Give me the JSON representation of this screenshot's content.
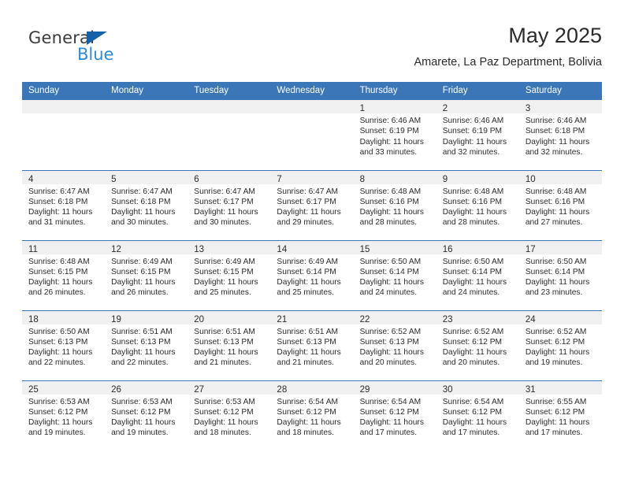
{
  "brand": {
    "name_part1": "General",
    "name_part2": "Blue",
    "color_dark": "#3b3b3b",
    "color_blue": "#2e8bd8",
    "triangle_color": "#1362a8"
  },
  "header": {
    "title": "May 2025",
    "subtitle": "Amarete, La Paz Department, Bolivia",
    "accent_color": "#3a76b8"
  },
  "weekdays": [
    "Sunday",
    "Monday",
    "Tuesday",
    "Wednesday",
    "Thursday",
    "Friday",
    "Saturday"
  ],
  "weeks": [
    [
      {
        "day": "",
        "lines": []
      },
      {
        "day": "",
        "lines": []
      },
      {
        "day": "",
        "lines": []
      },
      {
        "day": "",
        "lines": []
      },
      {
        "day": "1",
        "lines": [
          "Sunrise: 6:46 AM",
          "Sunset: 6:19 PM",
          "Daylight: 11 hours",
          "and 33 minutes."
        ]
      },
      {
        "day": "2",
        "lines": [
          "Sunrise: 6:46 AM",
          "Sunset: 6:19 PM",
          "Daylight: 11 hours",
          "and 32 minutes."
        ]
      },
      {
        "day": "3",
        "lines": [
          "Sunrise: 6:46 AM",
          "Sunset: 6:18 PM",
          "Daylight: 11 hours",
          "and 32 minutes."
        ]
      }
    ],
    [
      {
        "day": "4",
        "lines": [
          "Sunrise: 6:47 AM",
          "Sunset: 6:18 PM",
          "Daylight: 11 hours",
          "and 31 minutes."
        ]
      },
      {
        "day": "5",
        "lines": [
          "Sunrise: 6:47 AM",
          "Sunset: 6:18 PM",
          "Daylight: 11 hours",
          "and 30 minutes."
        ]
      },
      {
        "day": "6",
        "lines": [
          "Sunrise: 6:47 AM",
          "Sunset: 6:17 PM",
          "Daylight: 11 hours",
          "and 30 minutes."
        ]
      },
      {
        "day": "7",
        "lines": [
          "Sunrise: 6:47 AM",
          "Sunset: 6:17 PM",
          "Daylight: 11 hours",
          "and 29 minutes."
        ]
      },
      {
        "day": "8",
        "lines": [
          "Sunrise: 6:48 AM",
          "Sunset: 6:16 PM",
          "Daylight: 11 hours",
          "and 28 minutes."
        ]
      },
      {
        "day": "9",
        "lines": [
          "Sunrise: 6:48 AM",
          "Sunset: 6:16 PM",
          "Daylight: 11 hours",
          "and 28 minutes."
        ]
      },
      {
        "day": "10",
        "lines": [
          "Sunrise: 6:48 AM",
          "Sunset: 6:16 PM",
          "Daylight: 11 hours",
          "and 27 minutes."
        ]
      }
    ],
    [
      {
        "day": "11",
        "lines": [
          "Sunrise: 6:48 AM",
          "Sunset: 6:15 PM",
          "Daylight: 11 hours",
          "and 26 minutes."
        ]
      },
      {
        "day": "12",
        "lines": [
          "Sunrise: 6:49 AM",
          "Sunset: 6:15 PM",
          "Daylight: 11 hours",
          "and 26 minutes."
        ]
      },
      {
        "day": "13",
        "lines": [
          "Sunrise: 6:49 AM",
          "Sunset: 6:15 PM",
          "Daylight: 11 hours",
          "and 25 minutes."
        ]
      },
      {
        "day": "14",
        "lines": [
          "Sunrise: 6:49 AM",
          "Sunset: 6:14 PM",
          "Daylight: 11 hours",
          "and 25 minutes."
        ]
      },
      {
        "day": "15",
        "lines": [
          "Sunrise: 6:50 AM",
          "Sunset: 6:14 PM",
          "Daylight: 11 hours",
          "and 24 minutes."
        ]
      },
      {
        "day": "16",
        "lines": [
          "Sunrise: 6:50 AM",
          "Sunset: 6:14 PM",
          "Daylight: 11 hours",
          "and 24 minutes."
        ]
      },
      {
        "day": "17",
        "lines": [
          "Sunrise: 6:50 AM",
          "Sunset: 6:14 PM",
          "Daylight: 11 hours",
          "and 23 minutes."
        ]
      }
    ],
    [
      {
        "day": "18",
        "lines": [
          "Sunrise: 6:50 AM",
          "Sunset: 6:13 PM",
          "Daylight: 11 hours",
          "and 22 minutes."
        ]
      },
      {
        "day": "19",
        "lines": [
          "Sunrise: 6:51 AM",
          "Sunset: 6:13 PM",
          "Daylight: 11 hours",
          "and 22 minutes."
        ]
      },
      {
        "day": "20",
        "lines": [
          "Sunrise: 6:51 AM",
          "Sunset: 6:13 PM",
          "Daylight: 11 hours",
          "and 21 minutes."
        ]
      },
      {
        "day": "21",
        "lines": [
          "Sunrise: 6:51 AM",
          "Sunset: 6:13 PM",
          "Daylight: 11 hours",
          "and 21 minutes."
        ]
      },
      {
        "day": "22",
        "lines": [
          "Sunrise: 6:52 AM",
          "Sunset: 6:13 PM",
          "Daylight: 11 hours",
          "and 20 minutes."
        ]
      },
      {
        "day": "23",
        "lines": [
          "Sunrise: 6:52 AM",
          "Sunset: 6:12 PM",
          "Daylight: 11 hours",
          "and 20 minutes."
        ]
      },
      {
        "day": "24",
        "lines": [
          "Sunrise: 6:52 AM",
          "Sunset: 6:12 PM",
          "Daylight: 11 hours",
          "and 19 minutes."
        ]
      }
    ],
    [
      {
        "day": "25",
        "lines": [
          "Sunrise: 6:53 AM",
          "Sunset: 6:12 PM",
          "Daylight: 11 hours",
          "and 19 minutes."
        ]
      },
      {
        "day": "26",
        "lines": [
          "Sunrise: 6:53 AM",
          "Sunset: 6:12 PM",
          "Daylight: 11 hours",
          "and 19 minutes."
        ]
      },
      {
        "day": "27",
        "lines": [
          "Sunrise: 6:53 AM",
          "Sunset: 6:12 PM",
          "Daylight: 11 hours",
          "and 18 minutes."
        ]
      },
      {
        "day": "28",
        "lines": [
          "Sunrise: 6:54 AM",
          "Sunset: 6:12 PM",
          "Daylight: 11 hours",
          "and 18 minutes."
        ]
      },
      {
        "day": "29",
        "lines": [
          "Sunrise: 6:54 AM",
          "Sunset: 6:12 PM",
          "Daylight: 11 hours",
          "and 17 minutes."
        ]
      },
      {
        "day": "30",
        "lines": [
          "Sunrise: 6:54 AM",
          "Sunset: 6:12 PM",
          "Daylight: 11 hours",
          "and 17 minutes."
        ]
      },
      {
        "day": "31",
        "lines": [
          "Sunrise: 6:55 AM",
          "Sunset: 6:12 PM",
          "Daylight: 11 hours",
          "and 17 minutes."
        ]
      }
    ]
  ]
}
